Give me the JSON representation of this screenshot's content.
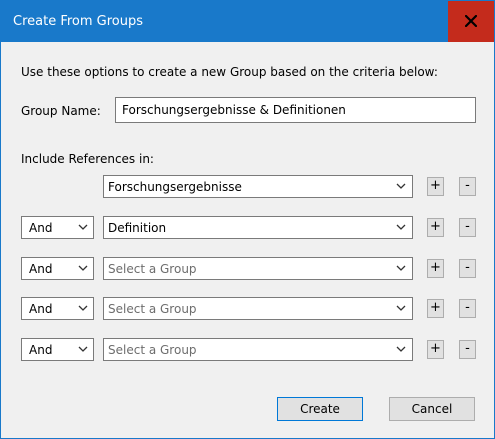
{
  "window": {
    "title": "Create From Groups",
    "close_icon": "close-icon",
    "titlebar_color": "#1979ca",
    "close_color": "#c42b1c"
  },
  "intro_text": "Use these options to create a new Group based on the criteria below:",
  "group_name": {
    "label": "Group Name:",
    "value": "Forschungsergebnisse & Definitionen"
  },
  "include_label": "Include References in:",
  "rows": [
    {
      "operator": "",
      "group": "Forschungsergebnisse",
      "is_placeholder": false
    },
    {
      "operator": "And",
      "group": "Definition",
      "is_placeholder": false
    },
    {
      "operator": "And",
      "group": "Select a Group",
      "is_placeholder": true
    },
    {
      "operator": "And",
      "group": "Select a Group",
      "is_placeholder": true
    },
    {
      "operator": "And",
      "group": "Select a Group",
      "is_placeholder": true
    }
  ],
  "row_buttons": {
    "add": "+",
    "remove": "-"
  },
  "buttons": {
    "create": "Create",
    "cancel": "Cancel"
  }
}
